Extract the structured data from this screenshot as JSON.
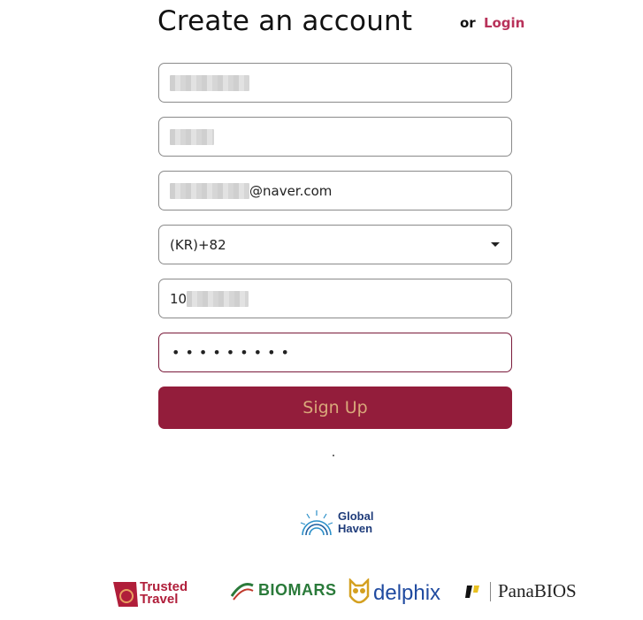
{
  "header": {
    "title": "Create an account",
    "login_prefix": "or",
    "login_link": "Login"
  },
  "form": {
    "email_suffix": "@naver.com",
    "country_code": "(KR)+82",
    "phone_prefix": "10",
    "password_mask": "•••••••••"
  },
  "signup_button": "Sign Up",
  "logos": {
    "global_haven_line1": "Global",
    "global_haven_line2": "Haven",
    "trusted_travel_line1": "Trusted",
    "trusted_travel_line2": "Travel",
    "biomars": "BIOMARS",
    "delphix": "delphix",
    "panabios": "PanaBIOS"
  },
  "colors": {
    "accent": "#931d3b",
    "button_text": "#d9a87a",
    "login_link": "#b8325a"
  }
}
